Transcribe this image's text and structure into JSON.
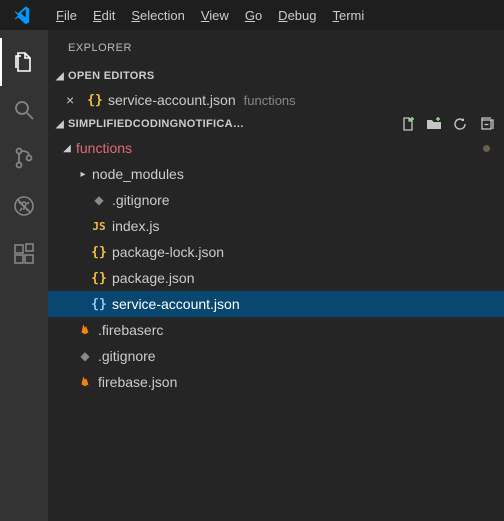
{
  "menubar": {
    "items": [
      {
        "label": "File",
        "mnemonic": "F"
      },
      {
        "label": "Edit",
        "mnemonic": "E"
      },
      {
        "label": "Selection",
        "mnemonic": "S"
      },
      {
        "label": "View",
        "mnemonic": "V"
      },
      {
        "label": "Go",
        "mnemonic": "G"
      },
      {
        "label": "Debug",
        "mnemonic": "D"
      },
      {
        "label": "Terminal",
        "mnemonic": "T"
      }
    ]
  },
  "sidebar": {
    "title": "EXPLORER",
    "openEditors": {
      "header": "OPEN EDITORS",
      "items": [
        {
          "name": "service-account.json",
          "desc": "functions",
          "iconType": "json"
        }
      ]
    },
    "workspace": {
      "header": "SIMPLIFIEDCODINGNOTIFICA…",
      "tree": [
        {
          "name": "functions",
          "type": "folder",
          "depth": 0,
          "expanded": true,
          "modified": true
        },
        {
          "name": "node_modules",
          "type": "folder",
          "depth": 1,
          "expanded": false
        },
        {
          "name": ".gitignore",
          "type": "file",
          "depth": 2,
          "iconType": "git"
        },
        {
          "name": "index.js",
          "type": "file",
          "depth": 2,
          "iconType": "js"
        },
        {
          "name": "package-lock.json",
          "type": "file",
          "depth": 2,
          "iconType": "json"
        },
        {
          "name": "package.json",
          "type": "file",
          "depth": 2,
          "iconType": "json"
        },
        {
          "name": "service-account.json",
          "type": "file",
          "depth": 2,
          "iconType": "json",
          "selected": true
        },
        {
          "name": ".firebaserc",
          "type": "file",
          "depth": 1,
          "iconType": "fire"
        },
        {
          "name": ".gitignore",
          "type": "file",
          "depth": 1,
          "iconType": "git"
        },
        {
          "name": "firebase.json",
          "type": "file",
          "depth": 1,
          "iconType": "fire"
        }
      ]
    }
  }
}
